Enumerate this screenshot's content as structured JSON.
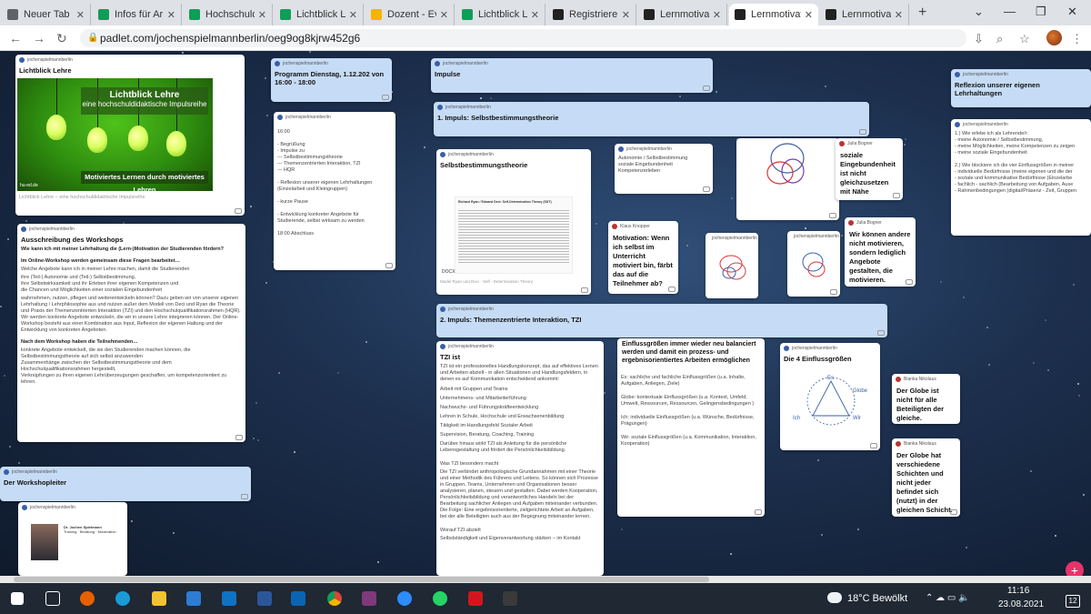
{
  "browser": {
    "tabs": [
      {
        "label": "Neuer Tab",
        "color": "#5f6368",
        "active": false
      },
      {
        "label": "Infos für Ar",
        "color": "#0f9d58",
        "active": false
      },
      {
        "label": "Hochschuld",
        "color": "#0f9d58",
        "active": false
      },
      {
        "label": "Lichtblick Le",
        "color": "#0f9d58",
        "active": false
      },
      {
        "label": "Dozent - Ev",
        "color": "#f4b400",
        "active": false
      },
      {
        "label": "Lichtblick Le",
        "color": "#0f9d58",
        "active": false
      },
      {
        "label": "Registriere",
        "color": "#222222",
        "active": false
      },
      {
        "label": "Lernmotivat",
        "color": "#222222",
        "active": false
      },
      {
        "label": "Lernmotivat",
        "color": "#222222",
        "active": true
      },
      {
        "label": "Lernmotivat",
        "color": "#222222",
        "active": false
      }
    ],
    "new_tab": "+",
    "url": "padlet.com/jochenspielmannberlin/oeg9og8kjrw452g6"
  },
  "padlet": {
    "author": "jochenspielmannberlin",
    "lichtblick": {
      "title": "Lichtblick Lehre",
      "banner_title": "Lichtblick Lehre",
      "banner_sub": "eine hochschuldidaktische Impulsreihe",
      "banner_bottom": "Motiviertes Lernen durch motiviertes Lehren",
      "caption": "Lichtblick Lehre – eine hochschuldidaktische Impulsreihe",
      "logo": "hu-ed.de"
    },
    "programm": {
      "title": "Programm Dienstag, 1.12.202 von 16:00 - 18:00"
    },
    "programm_detail": {
      "lines": [
        "16:00",
        "",
        "- Begrüßung",
        "- Impulse zu",
        "--- Selbstbestimmungstheorie",
        "--- Themenzentrierten Interaktion, TZI",
        "--- HQR",
        "",
        "- Reflexion unserer eigenen Lehrhaltungen",
        "(Einzelarbeit und Kleingruppen)",
        "",
        "- kurze Pause",
        "",
        "- Entwicklung konkreter Angebote für",
        "Studierende, selbst wirksam zu werden",
        "",
        "18:00 Abschluss"
      ]
    },
    "ausschreibung": {
      "title": "Ausschreibung des Workshops",
      "subtitle": "Wie kann ich mit meiner Lehrhaltung die (Lern-)Motivation der Studierenden fördern?",
      "intro": "Im Online-Workshop werden gemeinsam diese Fragen bearbeitet…",
      "lead": "Welche Angebote kann ich in meiner Lehre machen, damit die Studierenden",
      "bullets": [
        "ihre (Teil-) Autonomie und (Teil-) Selbstbestimmung,",
        "ihre Selbstwirksamkeit und ihr Erleben ihrer eigenen Kompetenzen und",
        "die Chancen und Möglichkeiten einer sozialen Eingebundenheit"
      ],
      "para": "wahrnehmen, nutzen, pflegen und weiterentwickeln können? Dazu geben wir von unserer eigenen Lehrhaltung / Lehrphilosophie aus und nutzen außer dem Modell von Deci und Ryan die Theorie und Praxis der Themenzentrierten Interaktion (TZI) und den Hochschulqualifikationsrahmen (HQR). Wir werden konkrete Angebote entwickeln, die wir in unsere Lehre integrieren können. Der Online-Workshop besteht aus einer Kombination aus Input, Reflexion der eigenen Haltung und der Entwicklung von konkreten Angeboten.",
      "after": "Nach dem Workshop haben die Teilnehmenden…",
      "bullets2": [
        "konkrete Angebote entwickelt, die sie den Studierenden machen können, die Selbstbestimmungstheorie auf sich selbst anzuwenden",
        "Zusammenhänge zwischen der Selbstbestimmungstheorie und dem Hochschulqualifikationsrahmen hergestellt,",
        "Verknüpfungen zu ihren eigenen Lehrüberzeugungen geschaffen, um kompetenzorientiert zu lehren."
      ]
    },
    "workshopleiter": {
      "title": "Der Workshopleiter"
    },
    "impulse": {
      "title": "Impulse"
    },
    "impuls1": {
      "title": "1. Impuls: Selbstbestimmungstheorie"
    },
    "sbt": {
      "title": "Selbstbestimmungstheorie",
      "doc_heading": "Richard Ryan / Edward Deci: Self-Determination Theory (SDT)",
      "badge": "DOCX",
      "caption": "Model Ryan und Deci - Self - Determination Theory"
    },
    "autonomie": {
      "lines": [
        "Autonomie / Selbstbestimmung",
        "soziale Eingebundenheit",
        "Kompetenzerleben"
      ]
    },
    "jb_sozial": {
      "author": "Julia Bogner",
      "text": "soziale Eingebundenheit ist nicht gleichzusetzen mit Nähe"
    },
    "jb_wir": {
      "author": "Julia Bogner",
      "text": "Wir können andere nicht motivieren, sondern lediglich Angebote gestalten, die motivieren."
    },
    "kk": {
      "author": "Klaus Knopper",
      "text": "Motivation: Wenn ich selbst im Unterricht motiviert bin, färbt das auf die Teilnehmer ab?"
    },
    "reflexion": {
      "title": "Reflexion unserer eigenen Lehrhaltungen"
    },
    "reflexion_detail": {
      "lines": [
        "1.) Wie erlebe ich als Lehrende/r:",
        "- meine Autonomie / Selbstbestimmung,",
        "- meine Möglichkeiten, meine Kompetenzen zu zeigen",
        "- meine soziale Eingebundenheit",
        "",
        "2.) Wie blockiere ich die vier Einflussgrößen in meiner",
        "- individuelle Bedürfnisse (meine eigenen und die der",
        "- soziale und kommunikative Bedürfnisse (Einzelarbe",
        "- fachlich - sachlich (Bearbeitung von Aufgaben, Ause",
        "- Rahmenbedingungen (digital/Präsenz - Zeit, Gruppen"
      ]
    },
    "impuls2": {
      "title": "2. Impuls: Themenzentrierte Interaktion, TZI"
    },
    "tzi": {
      "title": "TZI ist",
      "intro": "TZI ist ein professionelles Handlungskonzept, das auf effektives Lernen und Arbeiten abzielt - in allen Situationen und Handlungsfeldern, in denen es auf Kommunikation entscheidend ankommt:",
      "bullets": [
        "Arbeit mit Gruppen und Teams",
        "Unternehmens- und Mitarbeiterführung",
        "Nachwuchs- und Führungskräfteentwicklung",
        "Lehren in Schule, Hochschule und Erwachsenenbildung",
        "Tätigkeit im Handlungsfeld Sozialer Arbeit",
        "Supervision, Beratung, Coaching, Training"
      ],
      "after": "Darüber hinaus wirkt TZI als Anleitung für die persönliche Lebensgestaltung und fördert die Persönlichkeitsbildung.",
      "q": "Was TZI besonders macht",
      "para": "Die TZI verbindet anthropologische Grundannahmen mit einer Theorie und einer Methodik des Führens und Leitens. So können sich Prozesse in Gruppen, Teams, Unternehmen und Organisationen besser analysieren, planen, steuern und gestalten. Dabei werden Kooperation, Persönlichkeitsbildung und verantwortliches Handeln bei der Bearbeitung sachlicher Anliegen und Aufgaben miteinander verbunden. Die Folge: Eine ergebnisorientierte, zielgerichtete Arbeit an Aufgaben, bei der alle Beteiligten auch aus der Begegnung miteinander lernen.",
      "q2": "Worauf TZI abzielt",
      "last": "Selbstständigkeit und Eigenverantwortung stärken – im Kontakt"
    },
    "einfluss": {
      "title": "Einflussgrößen immer wieder neu balanciert werden und damit ein prozess- und ergebnisorientiertes Arbeiten ermöglichen",
      "lines": [
        "Es: sachliche und fachliche Einflussgrößen (u.a. Inhalte, Aufgaben, Anliegen, Ziele)",
        "Globe: kontextuale Einflussgrößen (u.a. Kontext, Umfeld, Umwelt, Ressourcen, Ressourcen, Gelingensbedingungen )",
        "Ich: individuelle Einflussgrößen (u.a. Wünsche, Bedürfnisse, Prägungen)",
        "Wir: soziale Einflussgrößen (u.a. Kommunikation, Interaktion, Kooperation)"
      ]
    },
    "einfluss4": {
      "title": "Die 4 Einflussgrößen",
      "labels": [
        "Es",
        "Globe",
        "Ich",
        "Wir"
      ]
    },
    "bn1": {
      "author": "Bianka Nikolaus",
      "text": "Der Globe ist nicht für alle Beteiligten der gleiche."
    },
    "bn2": {
      "author": "Bianka Nikolaus",
      "text": "Der Globe hat verschiedene Schichten und nicht jeder befindet sich (nutzt) in der gleichen Schicht."
    },
    "trainer": {
      "name": "Dr. Jochen Spielmann",
      "role": "Training · Beratung · Moderation"
    }
  },
  "taskbar": {
    "weather": "18°C Bewölkt",
    "time": "11:16",
    "date": "23.08.2021",
    "notifications": "12"
  },
  "colors": {
    "accent": "#e8326a",
    "card_blue": "#c6dcf6"
  }
}
